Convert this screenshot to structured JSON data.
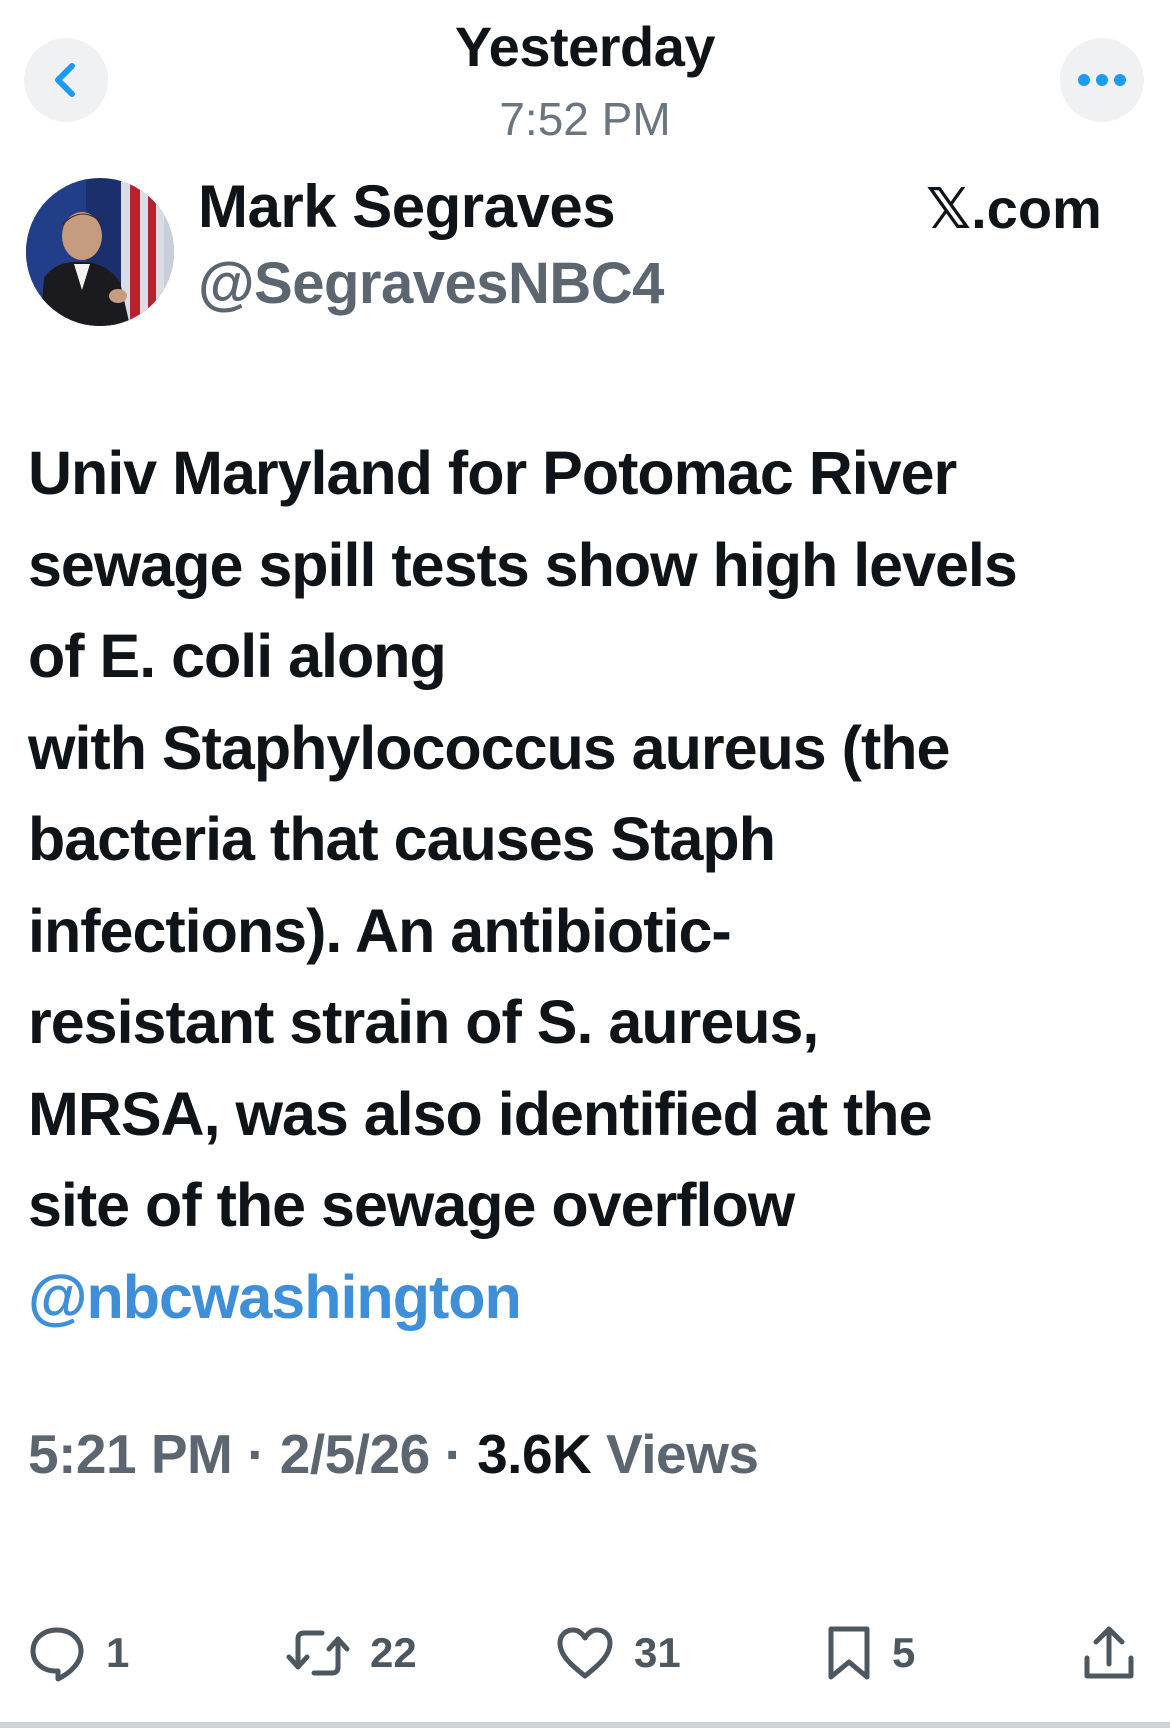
{
  "header": {
    "title": "Yesterday",
    "time": "7:52 PM",
    "back_icon": "chevron-left-icon",
    "more_icon": "more-horizontal-icon",
    "accent_color": "#1d9bf0"
  },
  "author": {
    "name": "Mark Segraves",
    "handle": "@SegravesNBC4",
    "source_prefix": "𝕏",
    "source_suffix": ".com"
  },
  "tweet": {
    "lines": [
      "Univ Maryland for Potomac River",
      "sewage spill tests show high levels",
      "of E. coli along",
      "with Staphylococcus aureus (the",
      "bacteria that causes Staph",
      "infections). An antibiotic-",
      "resistant strain of S. aureus,",
      "MRSA, was also identified at the",
      "site of the sewage overflow"
    ],
    "mention": "@nbcwashington",
    "mention_color": "#3f8fd8"
  },
  "meta": {
    "time": "5:21 PM",
    "sep1": " · ",
    "date": "2/5/26",
    "sep2": " · ",
    "views_count": "3.6K",
    "views_label": " Views"
  },
  "actions": {
    "reply": {
      "icon": "reply-icon",
      "count": "1"
    },
    "retweet": {
      "icon": "retweet-icon",
      "count": "22"
    },
    "like": {
      "icon": "heart-icon",
      "count": "31"
    },
    "bookmark": {
      "icon": "bookmark-icon",
      "count": "5"
    },
    "share": {
      "icon": "share-icon"
    }
  }
}
